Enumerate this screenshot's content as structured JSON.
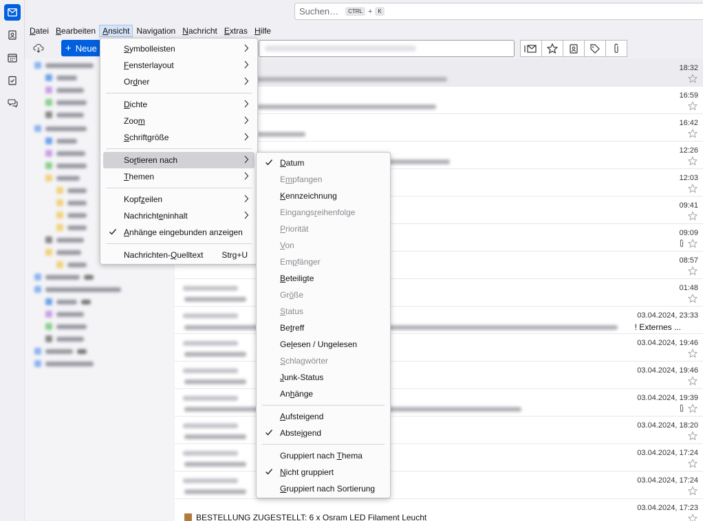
{
  "search": {
    "placeholder": "Suchen…",
    "key1": "CTRL",
    "plus": "+",
    "key2": "K"
  },
  "menubar": [
    {
      "label": "Datei",
      "ak": "D"
    },
    {
      "label": "Bearbeiten",
      "ak": "B"
    },
    {
      "label": "Ansicht",
      "ak": "A"
    },
    {
      "label": "Navigation",
      "ak": "N"
    },
    {
      "label": "Nachricht",
      "ak": "N"
    },
    {
      "label": "Extras",
      "ak": "E"
    },
    {
      "label": "Hilfe",
      "ak": "H"
    }
  ],
  "toolbar": {
    "new_label": "Neue"
  },
  "view_menu": {
    "items": {
      "toolbars": {
        "pre": "",
        "ak": "S",
        "post": "ymbolleisten"
      },
      "layout": {
        "pre": "",
        "ak": "F",
        "post": "ensterlayout"
      },
      "folders": {
        "pre": "Or",
        "ak": "d",
        "post": "ner"
      },
      "density": {
        "pre": "",
        "ak": "D",
        "post": "ichte"
      },
      "zoom": {
        "pre": "Zoo",
        "ak": "m",
        "post": ""
      },
      "fontsize": {
        "pre": "",
        "ak": "S",
        "post": "chriftgröße"
      },
      "sortby": {
        "pre": "So",
        "ak": "r",
        "post": "tieren nach"
      },
      "threads": {
        "pre": "",
        "ak": "T",
        "post": "hemen"
      },
      "headers": {
        "pre": "Kopf",
        "ak": "z",
        "post": "eilen"
      },
      "body": {
        "pre": "Nachricht",
        "ak": "e",
        "post": "ninhalt"
      },
      "attachments_inline": {
        "pre": "",
        "ak": "A",
        "post": "nhänge eingebunden anzeigen"
      },
      "source": {
        "pre": "Nachrichten-",
        "ak": "Q",
        "post": "uelltext"
      },
      "source_shortcut": "Strg+U"
    }
  },
  "sort_menu": {
    "date": {
      "pre": "",
      "ak": "D",
      "post": "atum"
    },
    "received": {
      "pre": "E",
      "ak": "m",
      "post": "pfangen"
    },
    "flag": {
      "pre": "",
      "ak": "K",
      "post": "ennzeichnung"
    },
    "order": {
      "pre": "Eingangs",
      "ak": "r",
      "post": "eihenfolge"
    },
    "priority": {
      "pre": "",
      "ak": "P",
      "post": "riorität"
    },
    "from": {
      "pre": "",
      "ak": "V",
      "post": "on"
    },
    "recipient": {
      "pre": "Em",
      "ak": "p",
      "post": "fänger"
    },
    "correspondents": {
      "pre": "",
      "ak": "B",
      "post": "eteiligte"
    },
    "size": {
      "pre": "Gr",
      "ak": "ö",
      "post": "ße"
    },
    "status": {
      "pre": "",
      "ak": "S",
      "post": "tatus"
    },
    "subject": {
      "pre": "Be",
      "ak": "t",
      "post": "reff"
    },
    "read": {
      "pre": "Ge",
      "ak": "l",
      "post": "esen / Ungelesen"
    },
    "tags": {
      "pre": "",
      "ak": "S",
      "post": "chlagwörter"
    },
    "junk": {
      "pre": "",
      "ak": "J",
      "post": "unk-Status"
    },
    "attachments": {
      "pre": "An",
      "ak": "h",
      "post": "änge"
    },
    "ascending": {
      "pre": "",
      "ak": "A",
      "post": "ufsteigend"
    },
    "descending": {
      "pre": "Abste",
      "ak": "i",
      "post": "gend"
    },
    "grouped_thread": {
      "pre": "Gruppiert nach ",
      "ak": "T",
      "post": "hema"
    },
    "not_grouped": {
      "pre": "",
      "ak": "N",
      "post": "icht gruppiert"
    },
    "grouped_sort": {
      "pre": "",
      "ak": "G",
      "post": "ruppiert nach Sortierung"
    }
  },
  "messages": [
    {
      "date": "18:32"
    },
    {
      "date": "16:59"
    },
    {
      "date": "16:42"
    },
    {
      "date": "12:26"
    },
    {
      "date": "12:03"
    },
    {
      "date": "09:41"
    },
    {
      "date": "09:09"
    },
    {
      "date": "08:57"
    },
    {
      "date": "01:48"
    },
    {
      "date": "03.04.2024, 23:33",
      "subject_tail": "! Externes ..."
    },
    {
      "date": "03.04.2024, 19:46"
    },
    {
      "date": "03.04.2024, 19:46"
    },
    {
      "date": "03.04.2024, 19:39"
    },
    {
      "date": "03.04.2024, 18:20"
    },
    {
      "date": "03.04.2024, 17:24"
    },
    {
      "date": "03.04.2024, 17:24"
    },
    {
      "date": "03.04.2024, 17:23"
    }
  ],
  "bottom_subject": "BESTELLUNG ZUGESTELLT: 6 x Osram LED Filament Leucht"
}
